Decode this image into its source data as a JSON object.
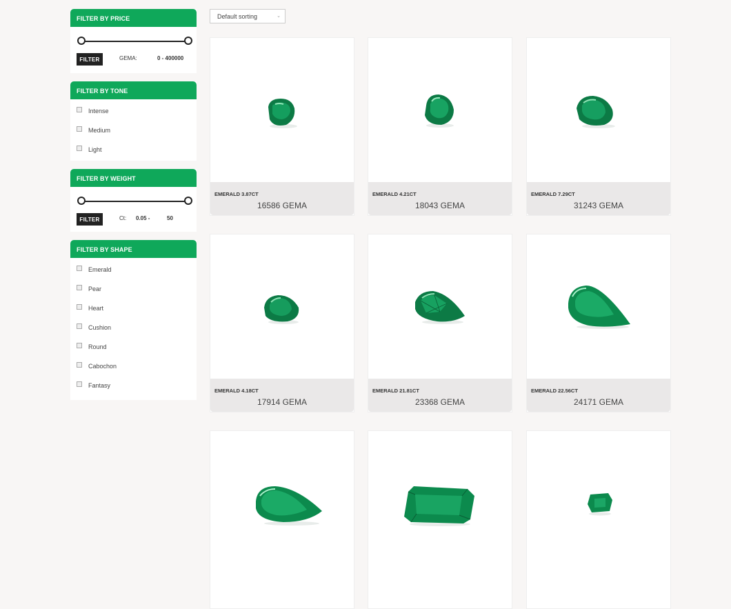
{
  "sidebar": {
    "price": {
      "title": "FILTER BY PRICE",
      "button": "FILTER",
      "label": "GEMA:",
      "range": "0 -  400000"
    },
    "tone": {
      "title": "FILTER BY TONE",
      "options": [
        "Intense",
        "Medium",
        "Light"
      ]
    },
    "weight": {
      "title": "FILTER BY WEIGHT",
      "button": "FILTER",
      "label": "Ct:",
      "min": "0.05 -",
      "max": "50"
    },
    "shape": {
      "title": "FILTER BY SHAPE",
      "options": [
        "Emerald",
        "Pear",
        "Heart",
        "Cushion",
        "Round",
        "Cabochon",
        "Fantasy"
      ]
    }
  },
  "sort": {
    "selected": "Default sorting"
  },
  "products": [
    {
      "name": "EMERALD 3.87CT",
      "price": "16586 GEMA"
    },
    {
      "name": "EMERALD 4.21CT",
      "price": "18043 GEMA"
    },
    {
      "name": "EMERALD 7.29CT",
      "price": "31243 GEMA"
    },
    {
      "name": "EMERALD 4.18CT",
      "price": "17914 GEMA"
    },
    {
      "name": "EMERALD 21.81CT",
      "price": "23368 GEMA"
    },
    {
      "name": "EMERALD 22.56CT",
      "price": "24171 GEMA"
    },
    {
      "name": "",
      "price": ""
    },
    {
      "name": "",
      "price": ""
    },
    {
      "name": "",
      "price": ""
    }
  ],
  "colors": {
    "accent": "#0fa85a",
    "button": "#222222",
    "card_info_bg": "#eae8e8",
    "gem": "#0f8a4f"
  }
}
